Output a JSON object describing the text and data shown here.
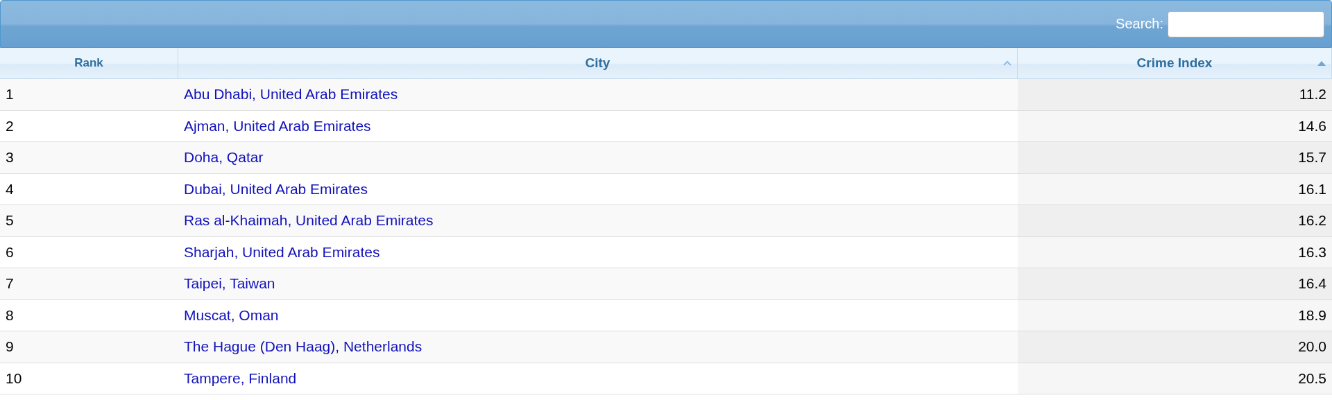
{
  "search": {
    "label": "Search:"
  },
  "table": {
    "columns": [
      {
        "label": "Rank",
        "sortable": false
      },
      {
        "label": "City",
        "sortable": true,
        "sorted": false
      },
      {
        "label": "Crime Index",
        "sortable": true,
        "sorted": true
      }
    ],
    "rows": [
      {
        "rank": "1",
        "city": "Abu Dhabi, United Arab Emirates",
        "crime_index": "11.2"
      },
      {
        "rank": "2",
        "city": "Ajman, United Arab Emirates",
        "crime_index": "14.6"
      },
      {
        "rank": "3",
        "city": "Doha, Qatar",
        "crime_index": "15.7"
      },
      {
        "rank": "4",
        "city": "Dubai, United Arab Emirates",
        "crime_index": "16.1"
      },
      {
        "rank": "5",
        "city": "Ras al-Khaimah, United Arab Emirates",
        "crime_index": "16.2"
      },
      {
        "rank": "6",
        "city": "Sharjah, United Arab Emirates",
        "crime_index": "16.3"
      },
      {
        "rank": "7",
        "city": "Taipei, Taiwan",
        "crime_index": "16.4"
      },
      {
        "rank": "8",
        "city": "Muscat, Oman",
        "crime_index": "18.9"
      },
      {
        "rank": "9",
        "city": "The Hague (Den Haag), Netherlands",
        "crime_index": "20.0"
      },
      {
        "rank": "10",
        "city": "Tampere, Finland",
        "crime_index": "20.5"
      }
    ]
  }
}
